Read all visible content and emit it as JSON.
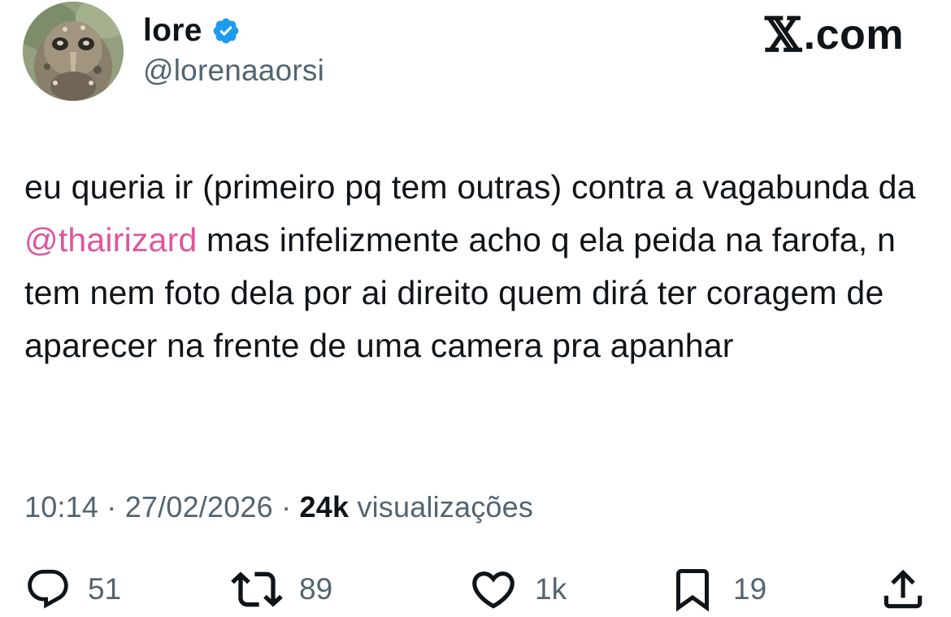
{
  "author": {
    "display_name": "lore",
    "handle": "@lorenaaorsi",
    "verified": true
  },
  "brand": {
    "logo_mark": "𝕏",
    "suffix": ".com"
  },
  "tweet": {
    "text_before": "eu queria ir (primeiro pq tem outras) contra a vagabunda da ",
    "mention": "@thairizard",
    "text_after": " mas infelizmente acho q ela peida na farofa, n tem nem foto dela por ai direito quem dirá ter coragem de aparecer na frente de uma camera pra apanhar"
  },
  "meta": {
    "time": "10:14",
    "separator": "·",
    "date": "27/02/2026",
    "views_count": "24k",
    "views_label": "visualizações"
  },
  "actions": {
    "replies": "51",
    "reposts": "89",
    "likes": "1k",
    "bookmarks": "19"
  },
  "icons": {
    "reply": "reply-icon",
    "repost": "repost-icon",
    "like": "heart-icon",
    "bookmark": "bookmark-icon",
    "share": "share-icon",
    "verified": "verified-badge-icon"
  },
  "colors": {
    "text": "#0f1419",
    "secondary": "#536471",
    "mention": "#e0549d",
    "verified": "#1d9bf0"
  }
}
